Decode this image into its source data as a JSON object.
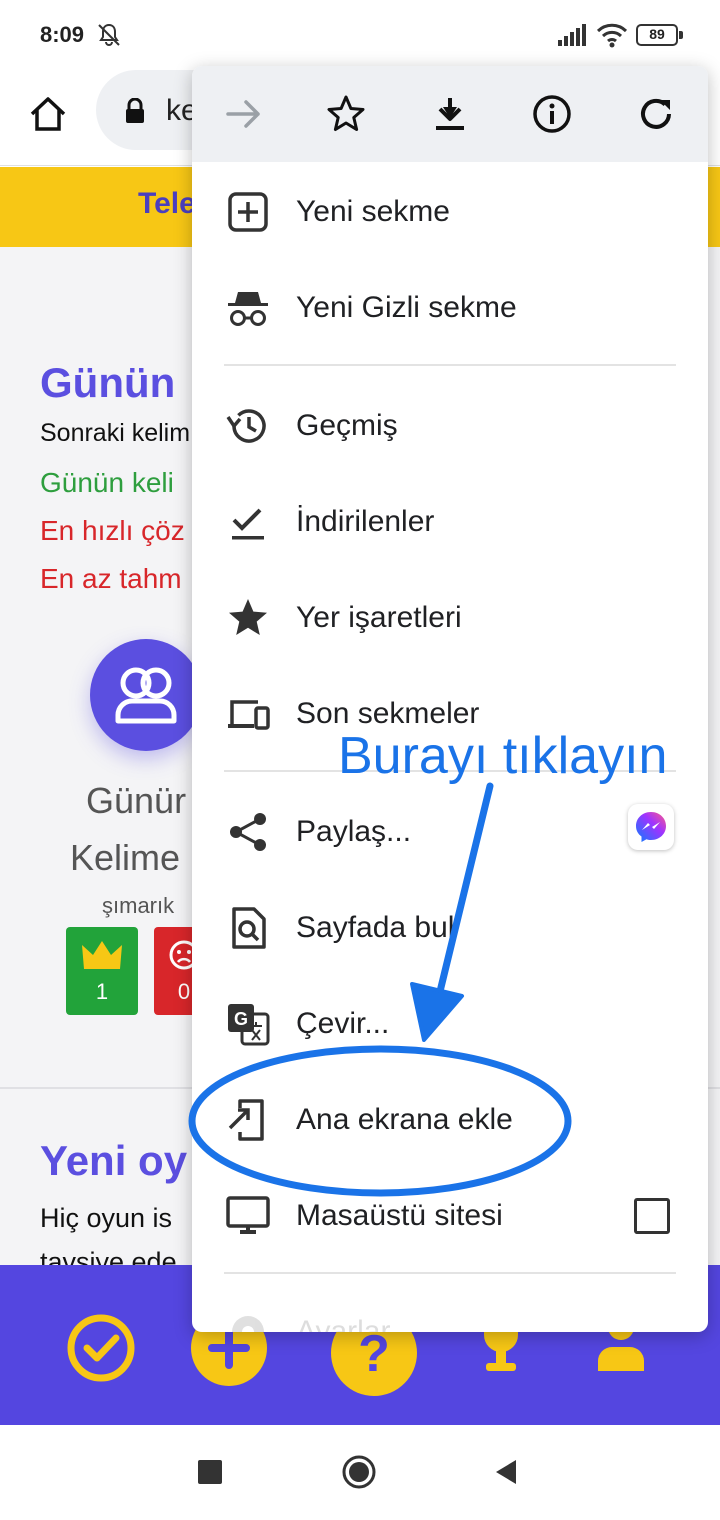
{
  "status_bar": {
    "time": "8:09",
    "battery": "89"
  },
  "browser_bar": {
    "url_fragment": "ke"
  },
  "page": {
    "banner_text": "Tele",
    "title": "Günün",
    "line1": "Sonraki kelim",
    "line2": "Günün keli",
    "line3": "En hızlı çöz",
    "line4": "En az tahm",
    "word1": "Günür",
    "word2": "Kelime",
    "small_word": "şımarık",
    "badge_green_value": "1",
    "badge_red_value": "0",
    "title2": "Yeni oy",
    "line5": "Hiç oyun is",
    "line6": "tavsiye ede"
  },
  "menu": {
    "top_icons": [
      "forward-arrow-icon",
      "star-icon",
      "download-icon",
      "info-icon",
      "refresh-icon"
    ],
    "items": [
      {
        "label": "Yeni sekme",
        "icon": "new-tab-icon"
      },
      {
        "label": "Yeni Gizli sekme",
        "icon": "incognito-icon"
      },
      {
        "label": "Geçmiş",
        "icon": "history-icon"
      },
      {
        "label": "İndirilenler",
        "icon": "downloads-check-icon"
      },
      {
        "label": "Yer işaretleri",
        "icon": "bookmark-star-icon"
      },
      {
        "label": "Son sekmeler",
        "icon": "devices-icon"
      },
      {
        "label": "Paylaş...",
        "icon": "share-icon"
      },
      {
        "label": "Sayfada bul",
        "icon": "find-in-page-icon"
      },
      {
        "label": "Çevir...",
        "icon": "translate-icon"
      },
      {
        "label": "Ana ekrana ekle",
        "icon": "add-to-home-icon"
      },
      {
        "label": "Masaüstü sitesi",
        "icon": "desktop-icon"
      },
      {
        "label": "Ayarlar",
        "icon": "settings-icon"
      }
    ]
  },
  "annotation": {
    "text": "Burayı tıklayın",
    "color": "#1a73e8"
  },
  "colors": {
    "accent": "#5446e0",
    "banner": "#f7c715",
    "annotation": "#1a73e8"
  }
}
